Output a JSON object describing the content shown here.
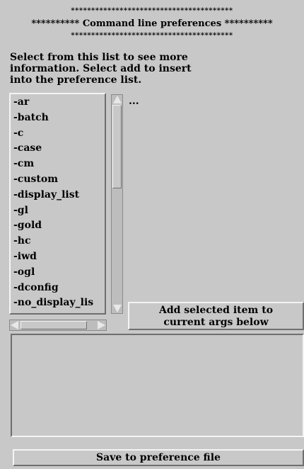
{
  "header": {
    "stars_top": "****************************************",
    "title_line": "********** Command line preferences **********",
    "stars_bottom": "****************************************"
  },
  "description": {
    "line1": "Select from this list to see more",
    "line2": "information. Select add to insert",
    "line3": "into the preference list."
  },
  "option_list": {
    "items": [
      "-ar",
      "-batch",
      "-c",
      "-case",
      "-cm",
      "-custom",
      "-display_list",
      "-gl",
      "-gold",
      "-hc",
      "-iwd",
      "-ogl",
      "-dconfig",
      "-no_display_lis"
    ]
  },
  "info_panel": {
    "text": "..."
  },
  "add_button": {
    "line1": "Add selected item to",
    "line2": "current args below"
  },
  "current_args": {
    "value": ""
  },
  "save_button": {
    "label": "Save to preference file"
  },
  "colors": {
    "background": "#c8c8c8",
    "highlight": "#f4f4f4",
    "shadow": "#6e6e6e"
  }
}
